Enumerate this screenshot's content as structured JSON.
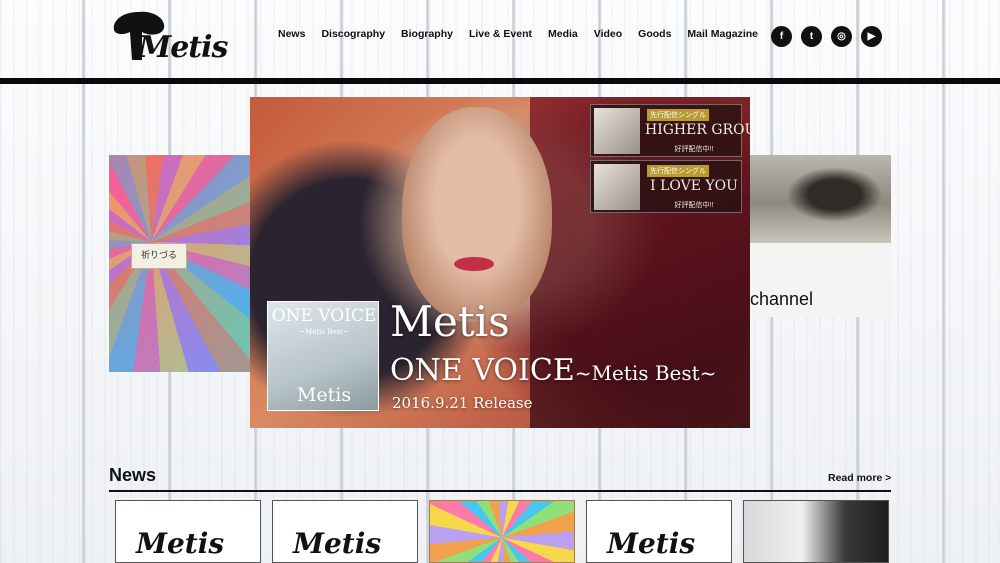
{
  "brand": {
    "name": "Metis"
  },
  "nav": {
    "items": [
      "News",
      "Discography",
      "Biography",
      "Live & Event",
      "Media",
      "Video",
      "Goods",
      "Mail Magazine"
    ]
  },
  "social": {
    "icons": [
      "facebook-icon",
      "twitter-icon",
      "instagram-icon",
      "youtube-icon"
    ],
    "glyphs": [
      "f",
      "t",
      "◎",
      "▶"
    ]
  },
  "carousel": {
    "left_slide": {
      "tag": "祈りづる"
    },
    "right_slide": {
      "label": "channel"
    },
    "hero": {
      "cover_title": "ONE VOICE",
      "cover_subtitle": "~Metis Best~",
      "cover_artist": "Metis",
      "title": "Metis",
      "subtitle_main": "ONE VOICE",
      "subtitle_tail": "~Metis Best~",
      "release": "2016.9.21 Release"
    },
    "promos": [
      {
        "badge": "先行配信シングル",
        "title": "HIGHER GROUND",
        "note": "好評配信中!!"
      },
      {
        "badge": "先行配信シングル",
        "title": "I LOVE YOU",
        "note": "好評配信中!!"
      }
    ]
  },
  "news": {
    "title": "News",
    "read_more": "Read more >"
  }
}
